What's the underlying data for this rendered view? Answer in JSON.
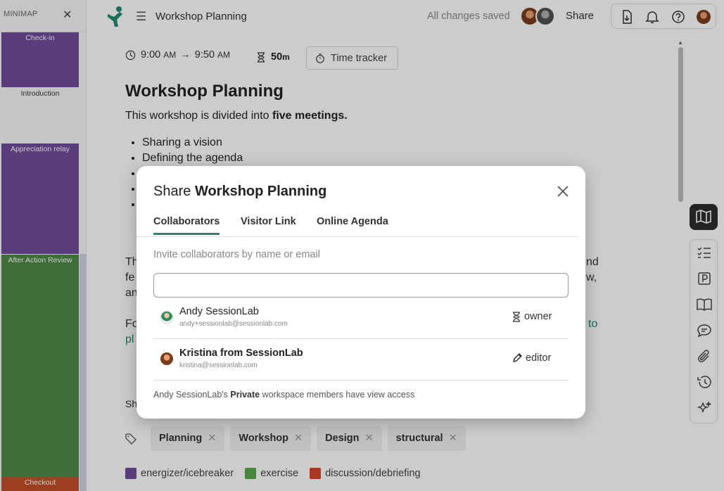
{
  "minimap": {
    "title": "MINIMAP",
    "blocks": [
      {
        "label": "Check-in",
        "color": "#6f4b9a"
      },
      {
        "label": "Introduction",
        "color": "#f7f7f7"
      },
      {
        "label": "Appreciation relay",
        "color": "#6f4b9a"
      },
      {
        "label": "After Action Review",
        "color": "#4e8a45"
      },
      {
        "label": "Checkout",
        "color": "#c5512b"
      }
    ]
  },
  "topbar": {
    "title": "Workshop Planning",
    "status": "All changes saved",
    "share_label": "Share"
  },
  "agenda": {
    "start": "9:00",
    "start_ampm": "AM",
    "end": "9:50",
    "end_ampm": "AM",
    "duration": "50",
    "duration_unit": "m",
    "time_tracker": "Time tracker",
    "heading": "Workshop Planning",
    "intro_pre": "This workshop is divided into ",
    "intro_bold": "five meetings.",
    "bullets": [
      "Sharing a vision",
      "Defining the agenda",
      "",
      "",
      ""
    ],
    "para_frags": [
      "Th",
      "fe",
      "an",
      "Fo",
      "Sh"
    ],
    "para_right": [
      "nd",
      "w,"
    ],
    "link_frags": [
      "pl",
      "to"
    ],
    "tags": [
      "Planning",
      "Workshop",
      "Design",
      "structural"
    ],
    "legend": [
      {
        "label": "energizer/icebreaker",
        "color": "#6f4b9a"
      },
      {
        "label": "exercise",
        "color": "#5aa84e"
      },
      {
        "label": "discussion/debriefing",
        "color": "#d6442b"
      }
    ]
  },
  "modal": {
    "title_prefix": "Share ",
    "title_bold": "Workshop Planning",
    "tabs": [
      "Collaborators",
      "Visitor Link",
      "Online Agenda"
    ],
    "invite_label": "Invite collaborators by name or email",
    "invite_value": "",
    "collaborators": [
      {
        "name": "Andy SessionLab",
        "email": "andy+sessionlab@sessionlab.com",
        "role": "owner"
      },
      {
        "name": "Kristina from SessionLab",
        "email": "kristina@sessionlab.com",
        "role": "editor"
      }
    ],
    "footer_pre": "Andy SessionLab's ",
    "footer_bold": "Private",
    "footer_post": " workspace members have view access"
  }
}
